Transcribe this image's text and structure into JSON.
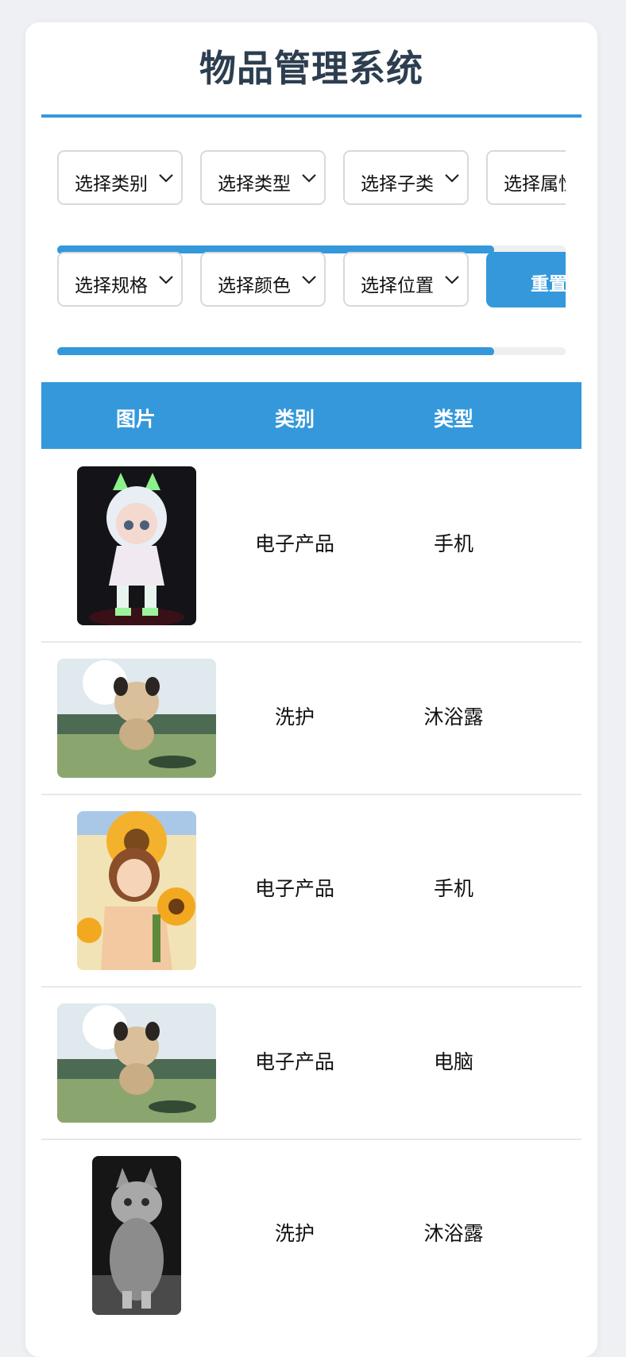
{
  "app": {
    "title": "物品管理系统",
    "accent_color": "#3498db"
  },
  "filters": {
    "row1": [
      {
        "label": "选择类别"
      },
      {
        "label": "选择类型"
      },
      {
        "label": "选择子类"
      },
      {
        "label": "选择属性"
      }
    ],
    "row2": [
      {
        "label": "选择规格"
      },
      {
        "label": "选择颜色"
      },
      {
        "label": "选择位置"
      }
    ],
    "reset_label": "重置",
    "scroll_position": 0.86
  },
  "table": {
    "columns": [
      "图片",
      "类别",
      "类型"
    ],
    "rows": [
      {
        "image_icon": "hooded-doll-photo",
        "category": "电子产品",
        "type": "手机"
      },
      {
        "image_icon": "running-dog-photo",
        "category": "洗护",
        "type": "沐浴露"
      },
      {
        "image_icon": "sunflower-girl-photo",
        "category": "电子产品",
        "type": "手机"
      },
      {
        "image_icon": "running-dog-photo",
        "category": "电子产品",
        "type": "电脑"
      },
      {
        "image_icon": "gray-cat-photo",
        "category": "洗护",
        "type": "沐浴露"
      }
    ]
  }
}
